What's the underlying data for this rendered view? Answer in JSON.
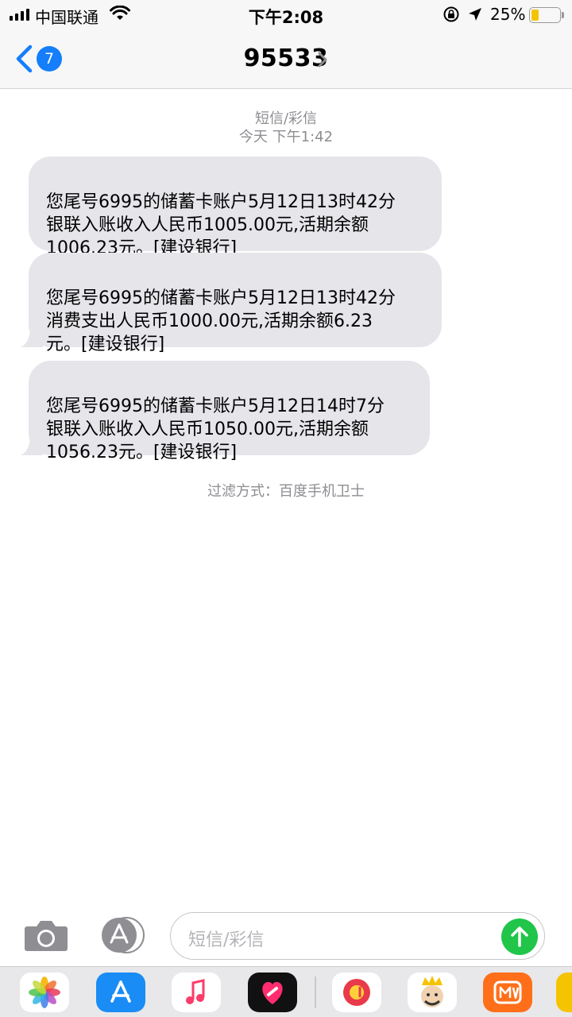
{
  "status_bar": {
    "carrier": "中国联通",
    "time": "下午2:08",
    "battery_percent": "25%",
    "battery_level": 0.25
  },
  "nav": {
    "back_badge": "7",
    "title": "95533",
    "accent": "#147efb"
  },
  "conversation": {
    "message_type": "短信/彩信",
    "timestamp": "今天 下午1:42",
    "messages": [
      {
        "text": "您尾号6995的储蓄卡账户5月12日13时42分\n银联入账收入人民币1005.00元,活期余额\n1006.23元。[建设银行]"
      },
      {
        "text": "您尾号6995的储蓄卡账户5月12日13时42分\n消费支出人民币1000.00元,活期余额6.23\n元。[建设银行]"
      },
      {
        "text": "您尾号6995的储蓄卡账户5月12日14时7分\n银联入账收入人民币1050.00元,活期余额\n1056.23元。[建设银行]"
      }
    ],
    "filter_note": "过滤方式：百度手机卫士"
  },
  "input_bar": {
    "placeholder": "短信/彩信",
    "send_color": "#20c54a"
  },
  "app_drawer": {
    "apps": [
      "photos-icon",
      "app-store-icon",
      "music-icon",
      "heart-app-icon",
      "music-note-app-icon",
      "king-avatar-app-icon",
      "mango-tv-icon"
    ]
  }
}
